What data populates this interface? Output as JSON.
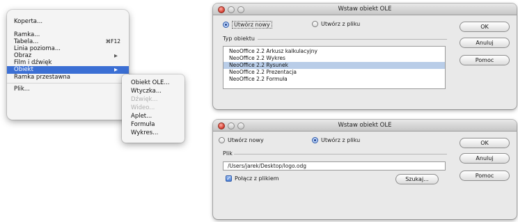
{
  "menu": {
    "items": [
      {
        "label": "Koperta..."
      },
      {
        "label": "Ramka..."
      },
      {
        "label": "Tabela...",
        "shortcut": "⌘F12"
      },
      {
        "label": "Linia pozioma..."
      },
      {
        "label": "Obraz"
      },
      {
        "label": "Film i dźwięk"
      },
      {
        "label": "Obiekt"
      },
      {
        "label": "Ramka przestawna"
      },
      {
        "label": "Plik..."
      }
    ],
    "submenu": [
      "Obiekt OLE...",
      "Wtyczka...",
      "Dźwięk...",
      "Wideo...",
      "Aplet...",
      "Formuła",
      "Wykres..."
    ]
  },
  "dialog1": {
    "title": "Wstaw obiekt OLE",
    "radio_new": "Utwórz nowy",
    "radio_file": "Utwórz z pliku",
    "group_label": "Typ obiektu",
    "list": [
      "NeoOffice 2.2 Arkusz kalkulacyjny",
      "NeoOffice 2.2 Wykres",
      "NeoOffice 2.2 Rysunek",
      "NeoOffice 2.2 Prezentacja",
      "NeoOffice 2.2 Formuła"
    ],
    "selected_index": 2,
    "ok": "OK",
    "cancel": "Anuluj",
    "help": "Pomoc"
  },
  "dialog2": {
    "title": "Wstaw obiekt OLE",
    "radio_new": "Utwórz nowy",
    "radio_file": "Utwórz z pliku",
    "group_label": "Plik",
    "path": "/Users/jarek/Desktop/logo.odg",
    "link_label": "Połącz z plikiem",
    "search": "Szukaj...",
    "ok": "OK",
    "cancel": "Anuluj",
    "help": "Pomoc"
  },
  "colors": {
    "highlight": "#3b6fd4",
    "list_selection": "#b9cde8"
  }
}
